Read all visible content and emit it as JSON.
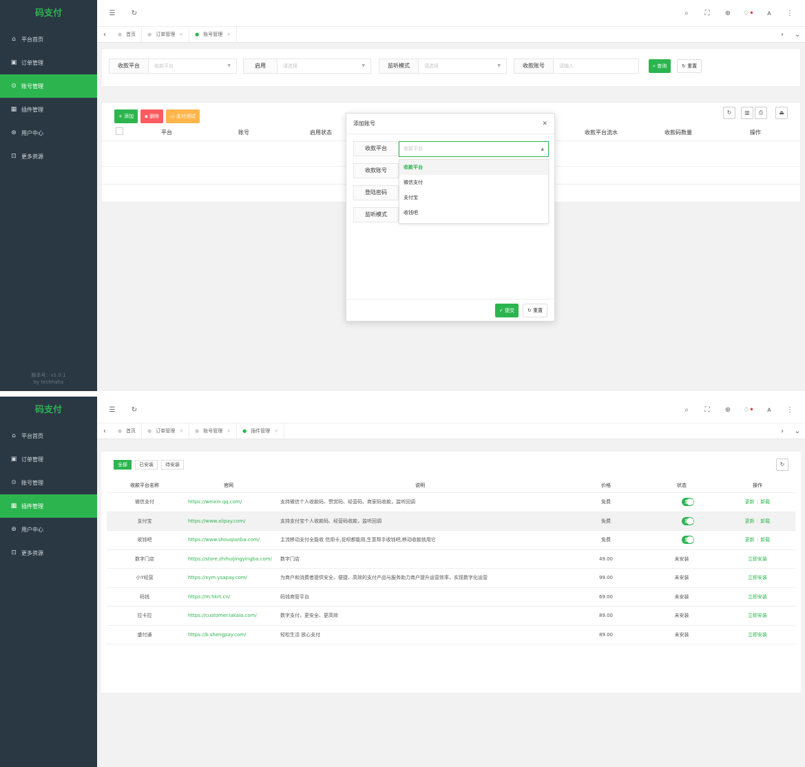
{
  "app": {
    "logo": "码支付",
    "version": "版本号：v1.0.1",
    "author": "by techhaha"
  },
  "colors": {
    "accent": "#2cb54f",
    "sidebar": "#293843",
    "danger": "#ff5a5f",
    "warning": "#ffb54a"
  },
  "sidebar": {
    "items": [
      {
        "label": "平台首页",
        "icon": "home-icon"
      },
      {
        "label": "订单管理",
        "icon": "order-icon"
      },
      {
        "label": "账号管理",
        "icon": "account-icon"
      },
      {
        "label": "插件管理",
        "icon": "plugin-icon"
      },
      {
        "label": "用户中心",
        "icon": "user-icon"
      },
      {
        "label": "更多资源",
        "icon": "resource-icon"
      }
    ]
  },
  "screen1": {
    "tabs": [
      {
        "label": "首页"
      },
      {
        "label": "订单管理"
      },
      {
        "label": "账号管理"
      }
    ],
    "search": {
      "platform_label": "收款平台",
      "platform_placeholder": "收款平台",
      "enable_label": "启用",
      "enable_placeholder": "请选择",
      "mode_label": "监听模式",
      "mode_placeholder": "请选择",
      "account_label": "收款账号",
      "account_placeholder": "请输入",
      "query_btn": "查询",
      "reset_btn": "重置"
    },
    "toolbar": {
      "add": "添加",
      "delete": "删除",
      "paytest": "支付测试"
    },
    "columns": [
      "平台",
      "账号",
      "启用状态",
      "收款平台流水",
      "收款码数量",
      "操作"
    ],
    "modal": {
      "title": "添加账号",
      "fields": [
        "收款平台",
        "收款账号",
        "登陆密码",
        "监听模式"
      ],
      "select_placeholder": "收款平台",
      "options": [
        "收款平台",
        "微信支付",
        "支付宝",
        "收钱吧"
      ],
      "submit": "提交",
      "reset": "重置"
    }
  },
  "screen2": {
    "tabs": [
      {
        "label": "首页"
      },
      {
        "label": "订单管理"
      },
      {
        "label": "账号管理"
      },
      {
        "label": "插件管理"
      }
    ],
    "filters": [
      "全部",
      "已安装",
      "待安装"
    ],
    "columns": {
      "name": "收款平台名称",
      "url": "官网",
      "desc": "说明",
      "price": "价格",
      "status": "状态",
      "op": "操作"
    },
    "rows": [
      {
        "name": "微信支付",
        "url": "https://weixin.qq.com/",
        "desc": "支持微信个人收款码、赞赏码、经营码、商家码收款，监听回调",
        "price": "免费",
        "status": "启用",
        "installed": true,
        "op1": "更新",
        "op2": "卸载"
      },
      {
        "name": "支付宝",
        "url": "https://www.alipay.com/",
        "desc": "支持支付宝个人收款码、经营码收款，监听回调",
        "price": "免费",
        "status": "启用",
        "installed": true,
        "op1": "更新",
        "op2": "卸载"
      },
      {
        "name": "收钱吧",
        "url": "https://www.shouqianba.com/",
        "desc": "主流移动支付全能收 信用卡,花呗都能用,生意帮手收钱吧,移动收款就用它",
        "price": "免费",
        "status": "启用",
        "installed": true,
        "op1": "更新",
        "op2": "卸载"
      },
      {
        "name": "数字门店",
        "url": "https://store.zhihuijingyingba.com/",
        "desc": "数字门店",
        "price": "49.00",
        "status": "未安装",
        "installed": false,
        "op1": "立即安装"
      },
      {
        "name": "小Y经营",
        "url": "https://xym.ysapay.com/",
        "desc": "为商户和消费者提供安全、便捷、高效的支付产品与服务助力商户提升运营效率，实现数字化运营",
        "price": "99.00",
        "status": "未安装",
        "installed": false,
        "op1": "立即安装"
      },
      {
        "name": "码钱",
        "url": "https://m.hkrt.cn/",
        "desc": "码钱商管平台",
        "price": "69.00",
        "status": "未安装",
        "installed": false,
        "op1": "立即安装"
      },
      {
        "name": "拉卡拉",
        "url": "https://customer.lakala.com/",
        "desc": "数字支付，更安全、更高效",
        "price": "89.00",
        "status": "未安装",
        "installed": false,
        "op1": "立即安装"
      },
      {
        "name": "盛付通",
        "url": "https://b.shengpay.com/",
        "desc": "轻松生活 放心支付",
        "price": "89.00",
        "status": "未安装",
        "installed": false,
        "op1": "立即安装"
      }
    ]
  }
}
